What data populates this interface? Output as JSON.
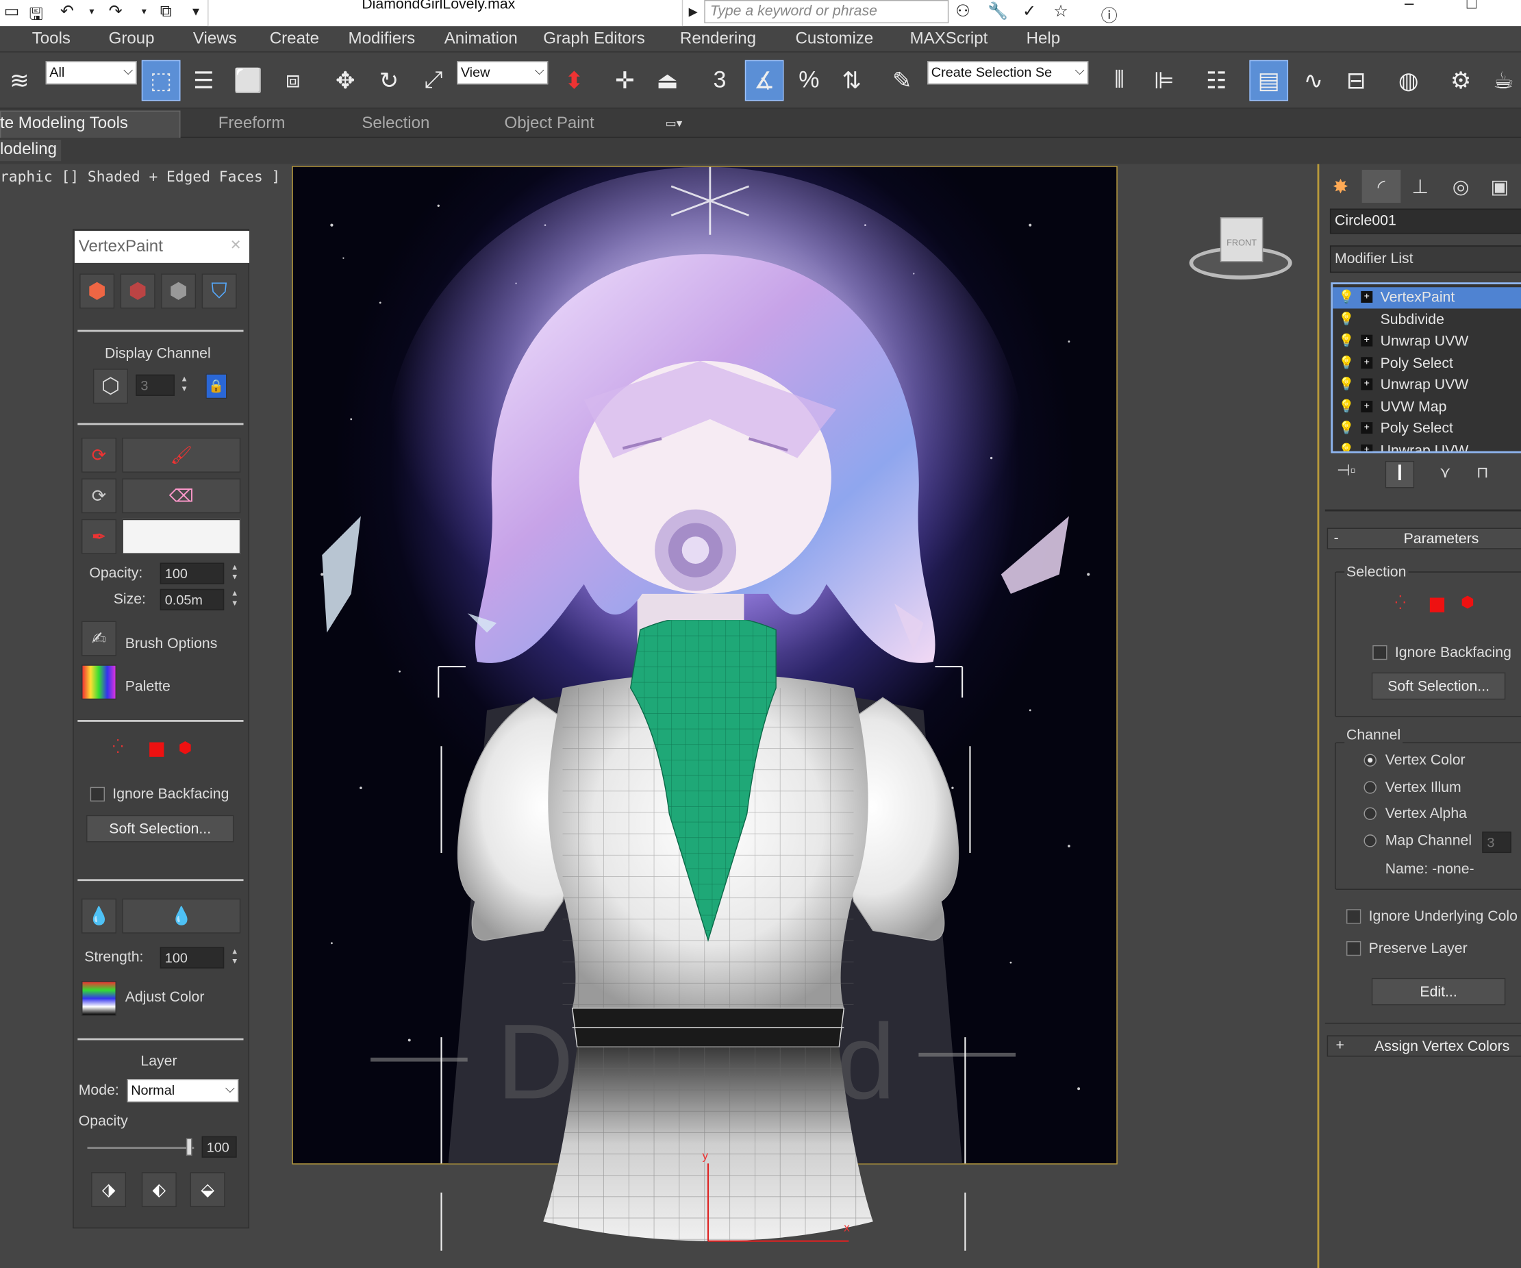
{
  "window": {
    "title": "DiamondGirlLovely.max",
    "search_placeholder": "Type a keyword or phrase"
  },
  "menu": [
    "Tools",
    "Group",
    "Views",
    "Create",
    "Modifiers",
    "Animation",
    "Graph Editors",
    "Rendering",
    "Customize",
    "MAXScript",
    "Help"
  ],
  "toolbar": {
    "selection_filter": "All",
    "ref_coord": "View",
    "named_selection": "Create Selection Se"
  },
  "ribbon": {
    "tabs": [
      "te Modeling Tools",
      "Freeform",
      "Selection",
      "Object Paint"
    ],
    "sub_label": "lodeling"
  },
  "viewport": {
    "label": "raphic [] Shaded + Edged Faces ]",
    "viewcube_label": "FRONT",
    "axis_x": "x",
    "axis_y": "y"
  },
  "vertexpaint": {
    "title": "VertexPaint",
    "display_channel_label": "Display Channel",
    "channel_value": "3",
    "opacity_label": "Opacity:",
    "opacity_value": "100",
    "size_label": "Size:",
    "size_value": "0.05m",
    "brush_options": "Brush Options",
    "palette": "Palette",
    "ignore_backfacing": "Ignore Backfacing",
    "soft_selection": "Soft Selection...",
    "strength_label": "Strength:",
    "strength_value": "100",
    "adjust_color": "Adjust Color",
    "layer_label": "Layer",
    "mode_label": "Mode:",
    "mode_value": "Normal",
    "layer_opacity_label": "Opacity",
    "layer_opacity_value": "100"
  },
  "command_panel": {
    "object_name": "Circle001",
    "modifier_list": "Modifier List",
    "stack": [
      {
        "name": "VertexPaint",
        "plus": true,
        "selected": true
      },
      {
        "name": "Subdivide",
        "plus": false,
        "selected": false
      },
      {
        "name": "Unwrap UVW",
        "plus": true,
        "selected": false
      },
      {
        "name": "Poly Select",
        "plus": true,
        "selected": false
      },
      {
        "name": "Unwrap UVW",
        "plus": true,
        "selected": false
      },
      {
        "name": "UVW Map",
        "plus": true,
        "selected": false
      },
      {
        "name": "Poly Select",
        "plus": true,
        "selected": false
      },
      {
        "name": "Unwrap UVW",
        "plus": true,
        "selected": false
      }
    ],
    "parameters": "Parameters",
    "parameters_toggle": "-",
    "selection_group": "Selection",
    "ignore_backfacing": "Ignore Backfacing",
    "soft_selection": "Soft Selection...",
    "channel_group": "Channel",
    "channels": [
      "Vertex Color",
      "Vertex Illum",
      "Vertex Alpha",
      "Map Channel"
    ],
    "map_channel_value": "3",
    "name_label": "Name: -none-",
    "ignore_underlying": "Ignore Underlying Colo",
    "preserve_layer": "Preserve Layer",
    "edit": "Edit...",
    "assign_rollup": "Assign Vertex Colors",
    "assign_toggle": "+"
  },
  "colors": {
    "accent": "#4f83d2",
    "shirt_collar": "#1fa877",
    "viewport_border": "#b89a3a"
  }
}
